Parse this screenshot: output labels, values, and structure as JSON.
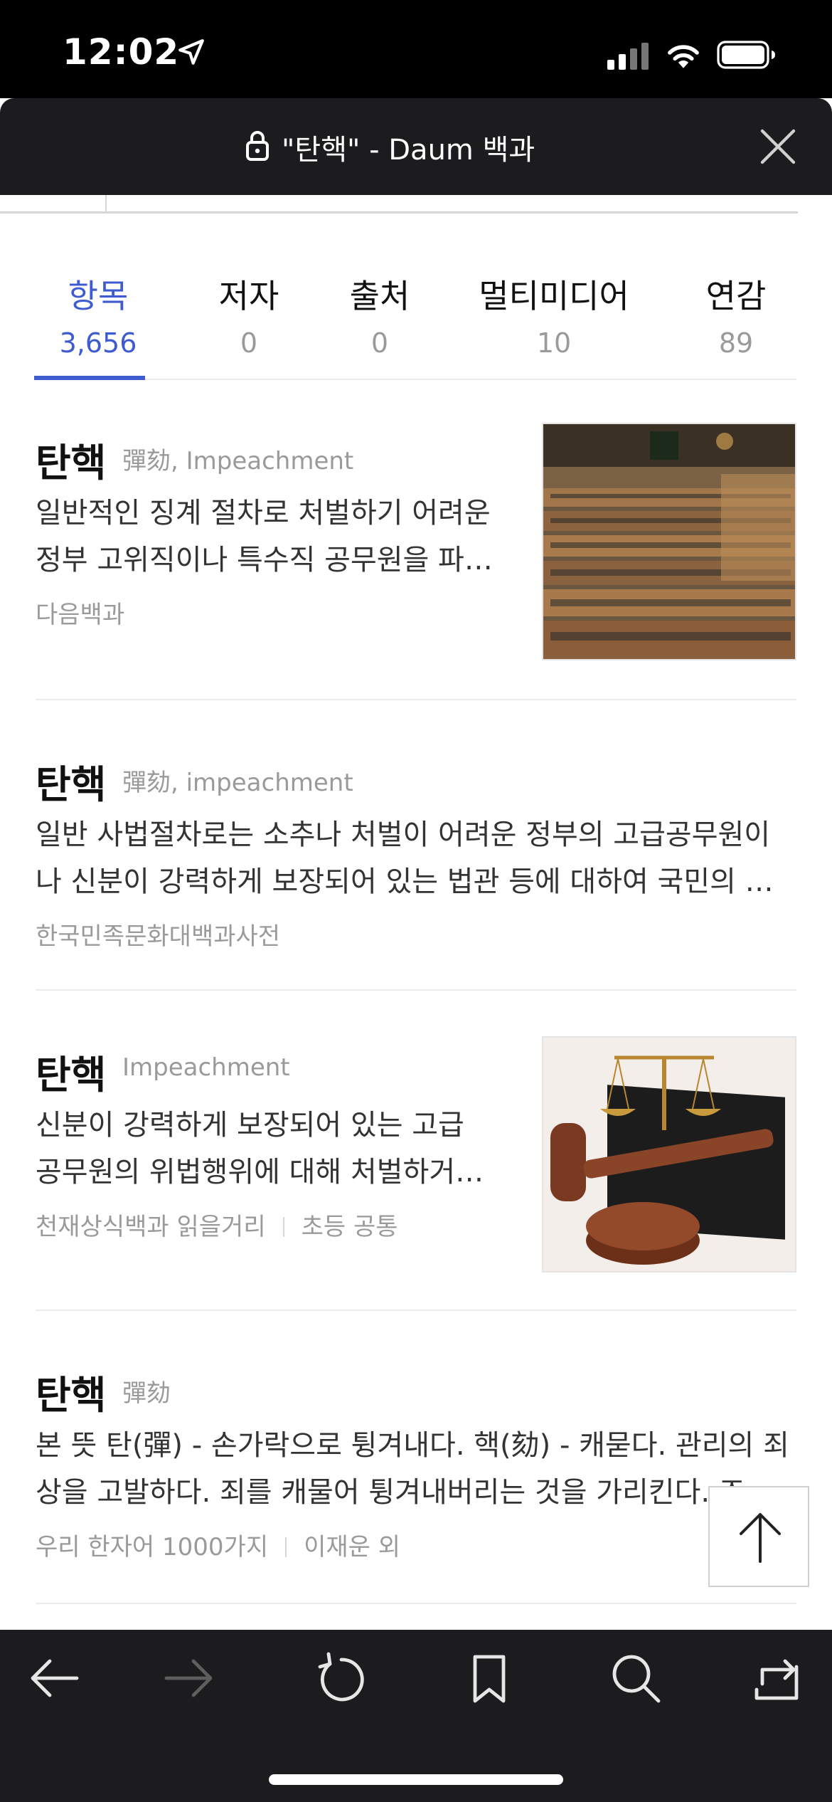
{
  "status_bar": {
    "time": "12:02"
  },
  "url_bar": {
    "title": "\"탄핵\" - Daum 백과"
  },
  "tabs": [
    {
      "label": "항목",
      "count": "3,656",
      "active": true
    },
    {
      "label": "저자",
      "count": "0"
    },
    {
      "label": "출처",
      "count": "0"
    },
    {
      "label": "멀티미디어",
      "count": "10"
    },
    {
      "label": "연감",
      "count": "89"
    }
  ],
  "entries": [
    {
      "title": "탄핵",
      "subtitle": "彈劾, Impeachment",
      "desc_lines": [
        "일반적인 징계 절차로 처벌하기 어려운",
        "정부 고위직이나 특수직 공무원을 파…"
      ],
      "source": "다음백과",
      "image": "national-assembly-hall"
    },
    {
      "title": "탄핵",
      "subtitle": "彈劾, impeachment",
      "desc_lines": [
        "일반 사법절차로는 소추나 처벌이 어려운 정부의 고급공무원이",
        "나 신분이 강력하게 보장되어 있는 법관 등에 대하여 국민의 …"
      ],
      "source": "한국민족문화대백과사전"
    },
    {
      "title": "탄핵",
      "subtitle": "Impeachment",
      "desc_lines": [
        "신분이 강력하게 보장되어 있는 고급",
        "공무원의 위법행위에 대해 처벌하거…"
      ],
      "source": "천재상식백과 읽을거리",
      "source_extra": "초등 공통",
      "image": "gavel-and-scales"
    },
    {
      "title": "탄핵",
      "subtitle": "彈劾",
      "desc_lines": [
        "본 뜻 탄(彈) - 손가락으로 튕겨내다. 핵(劾) - 캐묻다. 관리의 죄",
        "상을 고발하다. 죄를 캐물어 튕겨내버리는 것을 가리킨다. 조…"
      ],
      "source": "우리 한자어 1000가지",
      "source_extra": "이재운 외"
    }
  ],
  "icons": {
    "location": "location-arrow-icon",
    "signal": "cellular-signal-icon",
    "wifi": "wifi-icon",
    "battery": "battery-icon",
    "lock": "lock-icon",
    "close": "close-icon",
    "scroll_top": "arrow-up-icon",
    "back": "back-arrow-icon",
    "forward": "forward-arrow-icon",
    "reload": "reload-icon",
    "bookmark": "bookmark-icon",
    "search": "search-icon",
    "share": "share-icon"
  },
  "colors": {
    "accent": "#3f5bd0",
    "toolbar": "#1c1c1e"
  }
}
